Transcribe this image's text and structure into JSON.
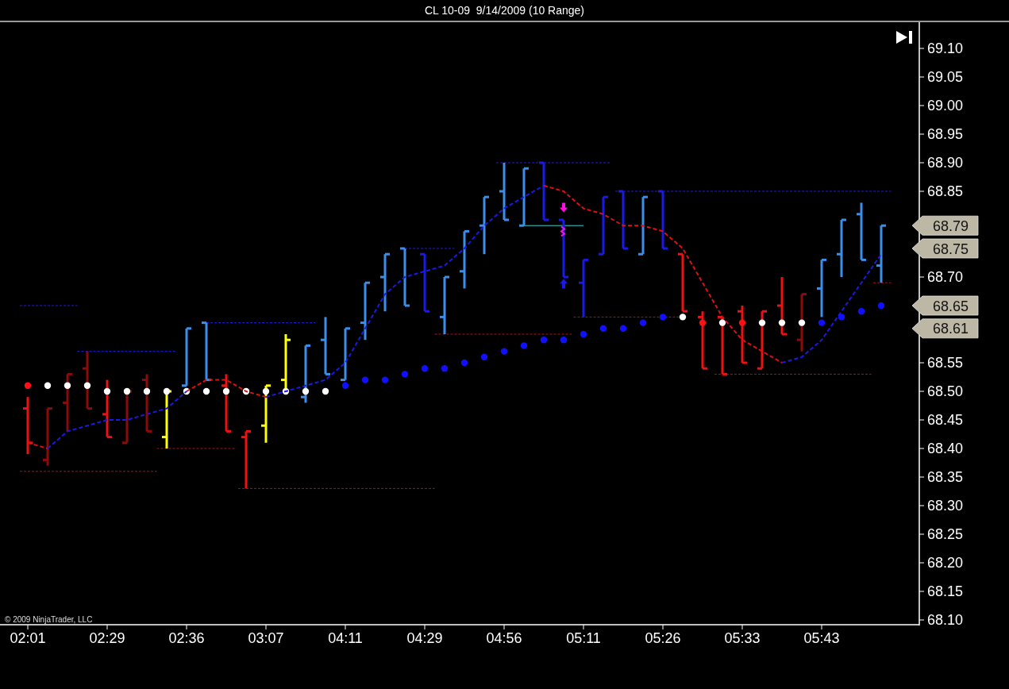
{
  "window": {
    "title": "CL 10-09  9/14/2009 (10 Range)"
  },
  "chart": {
    "copyright": "© 2009 NinjaTrader, LLC",
    "price_markers": [
      {
        "label": "68.79"
      },
      {
        "label": "68.75"
      },
      {
        "label": "68.65"
      },
      {
        "label": "68.61"
      }
    ],
    "chart_data": {
      "type": "line",
      "categories": [
        "02:01",
        null,
        null,
        null,
        "02:29",
        null,
        null,
        null,
        "02:36",
        null,
        null,
        null,
        "03:07",
        null,
        null,
        null,
        "04:11",
        null,
        null,
        null,
        "04:29",
        null,
        null,
        null,
        "04:56",
        null,
        null,
        null,
        "05:11",
        null,
        null,
        null,
        "05:26",
        null,
        null,
        null,
        "05:33",
        null,
        null,
        null,
        "05:43",
        null,
        null,
        null
      ],
      "ylim": [
        68.09,
        69.15
      ],
      "yticks": [
        {
          "value": 69.1,
          "label": "69.10"
        },
        {
          "value": 69.05,
          "label": "69.05"
        },
        {
          "value": 69.0,
          "label": "69.00"
        },
        {
          "value": 68.95,
          "label": "68.95"
        },
        {
          "value": 68.9,
          "label": "68.90"
        },
        {
          "value": 68.85,
          "label": "68.85"
        },
        {
          "value": 68.7,
          "label": "68.70"
        },
        {
          "value": 68.55,
          "label": "68.55"
        },
        {
          "value": 68.5,
          "label": "68.50"
        },
        {
          "value": 68.45,
          "label": "68.45"
        },
        {
          "value": 68.4,
          "label": "68.40"
        },
        {
          "value": 68.35,
          "label": "68.35"
        },
        {
          "value": 68.3,
          "label": "68.30"
        },
        {
          "value": 68.25,
          "label": "68.25"
        },
        {
          "value": 68.2,
          "label": "68.20"
        },
        {
          "value": 68.15,
          "label": "68.15"
        },
        {
          "value": 68.1,
          "label": "68.10"
        }
      ],
      "series": [
        {
          "color": "#e01010",
          "line_style": "dashed",
          "values": [
            68.41,
            68.4,
            null,
            null,
            null,
            null,
            null,
            null,
            68.5,
            68.52,
            68.52,
            68.5,
            68.49,
            null,
            null,
            null,
            null,
            null,
            null,
            null,
            null,
            null,
            null,
            null,
            null,
            null,
            68.86,
            68.85,
            68.82,
            68.81,
            68.79,
            68.79,
            68.78,
            68.75,
            68.69,
            68.63,
            68.59,
            68.57,
            68.55,
            null,
            null,
            null,
            null,
            null
          ]
        },
        {
          "color": "#1a1ae6",
          "line_style": "dashed",
          "values": [
            null,
            68.4,
            68.43,
            68.44,
            68.45,
            68.45,
            68.46,
            68.47,
            68.5,
            null,
            null,
            null,
            68.49,
            68.5,
            68.51,
            68.52,
            68.55,
            68.61,
            68.67,
            68.7,
            68.71,
            68.72,
            68.75,
            68.79,
            68.82,
            68.84,
            68.86,
            null,
            null,
            null,
            null,
            null,
            null,
            null,
            null,
            null,
            null,
            null,
            68.55,
            68.56,
            68.59,
            68.64,
            68.69,
            68.74
          ]
        }
      ]
    }
  }
}
